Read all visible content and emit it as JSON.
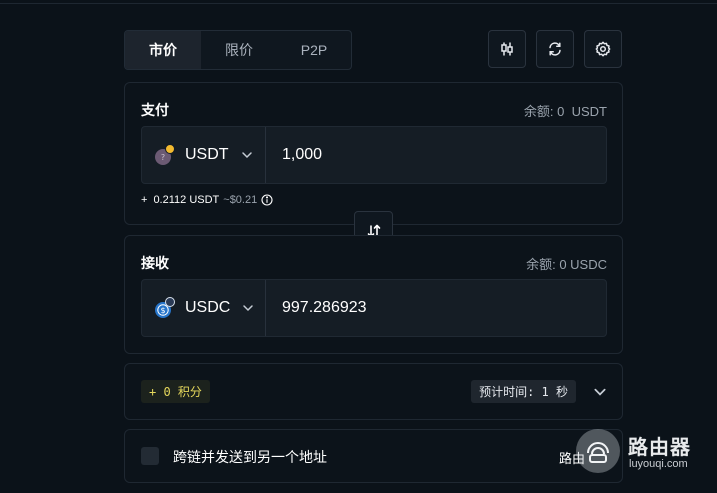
{
  "tabs": [
    {
      "label": "市价",
      "active": true
    },
    {
      "label": "限价",
      "active": false
    },
    {
      "label": "P2P",
      "active": false
    }
  ],
  "toolbar": {
    "icons": [
      "candlestick-chart-icon",
      "refresh-icon",
      "settings-gear-icon"
    ]
  },
  "pay": {
    "title": "支付",
    "balance": "余额: 0  USDT",
    "token": "USDT",
    "amount": "1,000",
    "fee_prefix": "+",
    "fee_amount": "0.2112 USDT",
    "fee_usd": "~$0.21"
  },
  "receive": {
    "title": "接收",
    "balance": "余额: 0 USDC",
    "token": "USDC",
    "amount": "997.286923"
  },
  "info": {
    "points": "+ 0 积分",
    "eta": "预计时间: 1 秒"
  },
  "crosschain": {
    "label": "跨链并发送到另一个地址",
    "route_label": "路由"
  },
  "watermark": {
    "title": "路由器",
    "url": "luyouqi.com"
  },
  "colors": {
    "background": "#0b1219",
    "usdt_badge": "#f3ba2f",
    "usdc_blue": "#2775ca",
    "points_text": "#e6d85c"
  }
}
